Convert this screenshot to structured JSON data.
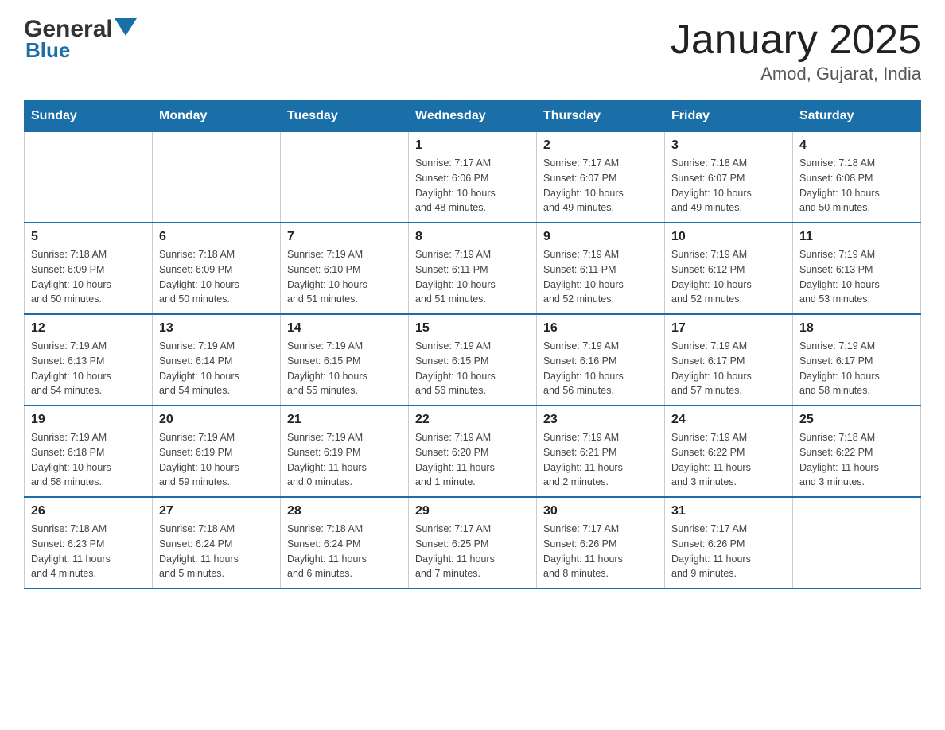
{
  "header": {
    "logo_general": "General",
    "logo_blue": "Blue",
    "title": "January 2025",
    "subtitle": "Amod, Gujarat, India"
  },
  "weekdays": [
    "Sunday",
    "Monday",
    "Tuesday",
    "Wednesday",
    "Thursday",
    "Friday",
    "Saturday"
  ],
  "weeks": [
    [
      {
        "day": "",
        "info": ""
      },
      {
        "day": "",
        "info": ""
      },
      {
        "day": "",
        "info": ""
      },
      {
        "day": "1",
        "info": "Sunrise: 7:17 AM\nSunset: 6:06 PM\nDaylight: 10 hours\nand 48 minutes."
      },
      {
        "day": "2",
        "info": "Sunrise: 7:17 AM\nSunset: 6:07 PM\nDaylight: 10 hours\nand 49 minutes."
      },
      {
        "day": "3",
        "info": "Sunrise: 7:18 AM\nSunset: 6:07 PM\nDaylight: 10 hours\nand 49 minutes."
      },
      {
        "day": "4",
        "info": "Sunrise: 7:18 AM\nSunset: 6:08 PM\nDaylight: 10 hours\nand 50 minutes."
      }
    ],
    [
      {
        "day": "5",
        "info": "Sunrise: 7:18 AM\nSunset: 6:09 PM\nDaylight: 10 hours\nand 50 minutes."
      },
      {
        "day": "6",
        "info": "Sunrise: 7:18 AM\nSunset: 6:09 PM\nDaylight: 10 hours\nand 50 minutes."
      },
      {
        "day": "7",
        "info": "Sunrise: 7:19 AM\nSunset: 6:10 PM\nDaylight: 10 hours\nand 51 minutes."
      },
      {
        "day": "8",
        "info": "Sunrise: 7:19 AM\nSunset: 6:11 PM\nDaylight: 10 hours\nand 51 minutes."
      },
      {
        "day": "9",
        "info": "Sunrise: 7:19 AM\nSunset: 6:11 PM\nDaylight: 10 hours\nand 52 minutes."
      },
      {
        "day": "10",
        "info": "Sunrise: 7:19 AM\nSunset: 6:12 PM\nDaylight: 10 hours\nand 52 minutes."
      },
      {
        "day": "11",
        "info": "Sunrise: 7:19 AM\nSunset: 6:13 PM\nDaylight: 10 hours\nand 53 minutes."
      }
    ],
    [
      {
        "day": "12",
        "info": "Sunrise: 7:19 AM\nSunset: 6:13 PM\nDaylight: 10 hours\nand 54 minutes."
      },
      {
        "day": "13",
        "info": "Sunrise: 7:19 AM\nSunset: 6:14 PM\nDaylight: 10 hours\nand 54 minutes."
      },
      {
        "day": "14",
        "info": "Sunrise: 7:19 AM\nSunset: 6:15 PM\nDaylight: 10 hours\nand 55 minutes."
      },
      {
        "day": "15",
        "info": "Sunrise: 7:19 AM\nSunset: 6:15 PM\nDaylight: 10 hours\nand 56 minutes."
      },
      {
        "day": "16",
        "info": "Sunrise: 7:19 AM\nSunset: 6:16 PM\nDaylight: 10 hours\nand 56 minutes."
      },
      {
        "day": "17",
        "info": "Sunrise: 7:19 AM\nSunset: 6:17 PM\nDaylight: 10 hours\nand 57 minutes."
      },
      {
        "day": "18",
        "info": "Sunrise: 7:19 AM\nSunset: 6:17 PM\nDaylight: 10 hours\nand 58 minutes."
      }
    ],
    [
      {
        "day": "19",
        "info": "Sunrise: 7:19 AM\nSunset: 6:18 PM\nDaylight: 10 hours\nand 58 minutes."
      },
      {
        "day": "20",
        "info": "Sunrise: 7:19 AM\nSunset: 6:19 PM\nDaylight: 10 hours\nand 59 minutes."
      },
      {
        "day": "21",
        "info": "Sunrise: 7:19 AM\nSunset: 6:19 PM\nDaylight: 11 hours\nand 0 minutes."
      },
      {
        "day": "22",
        "info": "Sunrise: 7:19 AM\nSunset: 6:20 PM\nDaylight: 11 hours\nand 1 minute."
      },
      {
        "day": "23",
        "info": "Sunrise: 7:19 AM\nSunset: 6:21 PM\nDaylight: 11 hours\nand 2 minutes."
      },
      {
        "day": "24",
        "info": "Sunrise: 7:19 AM\nSunset: 6:22 PM\nDaylight: 11 hours\nand 3 minutes."
      },
      {
        "day": "25",
        "info": "Sunrise: 7:18 AM\nSunset: 6:22 PM\nDaylight: 11 hours\nand 3 minutes."
      }
    ],
    [
      {
        "day": "26",
        "info": "Sunrise: 7:18 AM\nSunset: 6:23 PM\nDaylight: 11 hours\nand 4 minutes."
      },
      {
        "day": "27",
        "info": "Sunrise: 7:18 AM\nSunset: 6:24 PM\nDaylight: 11 hours\nand 5 minutes."
      },
      {
        "day": "28",
        "info": "Sunrise: 7:18 AM\nSunset: 6:24 PM\nDaylight: 11 hours\nand 6 minutes."
      },
      {
        "day": "29",
        "info": "Sunrise: 7:17 AM\nSunset: 6:25 PM\nDaylight: 11 hours\nand 7 minutes."
      },
      {
        "day": "30",
        "info": "Sunrise: 7:17 AM\nSunset: 6:26 PM\nDaylight: 11 hours\nand 8 minutes."
      },
      {
        "day": "31",
        "info": "Sunrise: 7:17 AM\nSunset: 6:26 PM\nDaylight: 11 hours\nand 9 minutes."
      },
      {
        "day": "",
        "info": ""
      }
    ]
  ]
}
